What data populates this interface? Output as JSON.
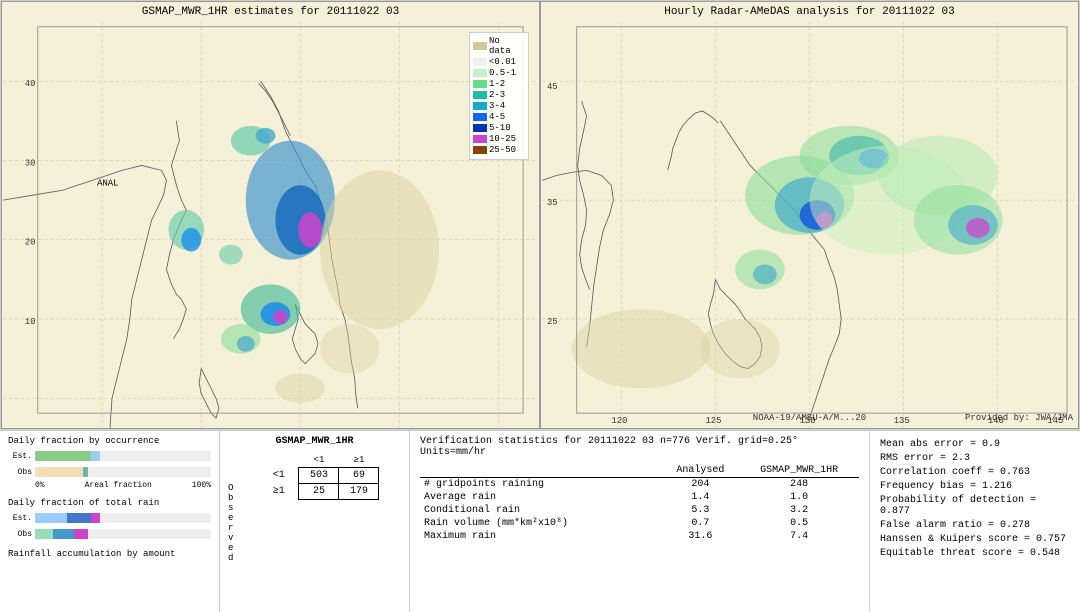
{
  "left_map": {
    "title": "GSMAP_MWR_1HR estimates for 20111022 03",
    "attribution": ""
  },
  "right_map": {
    "title": "Hourly Radar-AMeDAS analysis for 20111022 03",
    "attribution_left": "NOAA-19/AMSU-A/M...20",
    "attribution_right": "Provided by: JWA/JMA"
  },
  "legend": {
    "title": "",
    "items": [
      {
        "label": "No data",
        "color": "#d4c99a"
      },
      {
        "label": "<0.01",
        "color": "#f5f5f5"
      },
      {
        "label": "0.5-1",
        "color": "#c8f0c8"
      },
      {
        "label": "1-2",
        "color": "#88dd88"
      },
      {
        "label": "2-3",
        "color": "#44bb99"
      },
      {
        "label": "3-4",
        "color": "#22aacc"
      },
      {
        "label": "4-5",
        "color": "#1188ee"
      },
      {
        "label": "5-10",
        "color": "#0044cc"
      },
      {
        "label": "10-25",
        "color": "#cc44cc"
      },
      {
        "label": "25-50",
        "color": "#884400"
      }
    ]
  },
  "charts": {
    "occurrence_title": "Daily fraction by occurrence",
    "total_rain_title": "Daily fraction of total rain",
    "accumulation_label": "Rainfall accumulation by amount",
    "est_label": "Est.",
    "obs_label": "Obs",
    "axis_start": "0%",
    "axis_end": "100%",
    "axis_mid": "Areal fraction"
  },
  "contingency": {
    "title": "GSMAP_MWR_1HR",
    "col_header_1": "<1",
    "col_header_2": "≥1",
    "row_header_1": "<1",
    "row_header_2": "≥1",
    "obs_label": "O\nb\ns\ne\nr\nv\ne\nd",
    "cell_a": "503",
    "cell_b": "69",
    "cell_c": "25",
    "cell_d": "179"
  },
  "verification": {
    "title": "Verification statistics for 20111022 03  n=776  Verif. grid=0.25°  Units=mm/hr",
    "col_analysed": "Analysed",
    "col_gsmap": "GSMAP_MWR_1HR",
    "divider": "---------------------------------------------------------------------",
    "rows": [
      {
        "label": "# gridpoints raining",
        "val_a": "204",
        "val_b": "248"
      },
      {
        "label": "Average rain",
        "val_a": "1.4",
        "val_b": "1.0"
      },
      {
        "label": "Conditional rain",
        "val_a": "5.3",
        "val_b": "3.2"
      },
      {
        "label": "Rain volume (mm*km²x10⁸)",
        "val_a": "0.7",
        "val_b": "0.5"
      },
      {
        "label": "Maximum rain",
        "val_a": "31.6",
        "val_b": "7.4"
      }
    ]
  },
  "right_stats": {
    "lines": [
      "Mean abs error = 0.9",
      "RMS error = 2.3",
      "Correlation coeff = 0.763",
      "Frequency bias = 1.216",
      "Probability of detection = 0.877",
      "False alarm ratio = 0.278",
      "Hanssen & Kuipers score = 0.757",
      "Equitable threat score = 0.548"
    ]
  }
}
